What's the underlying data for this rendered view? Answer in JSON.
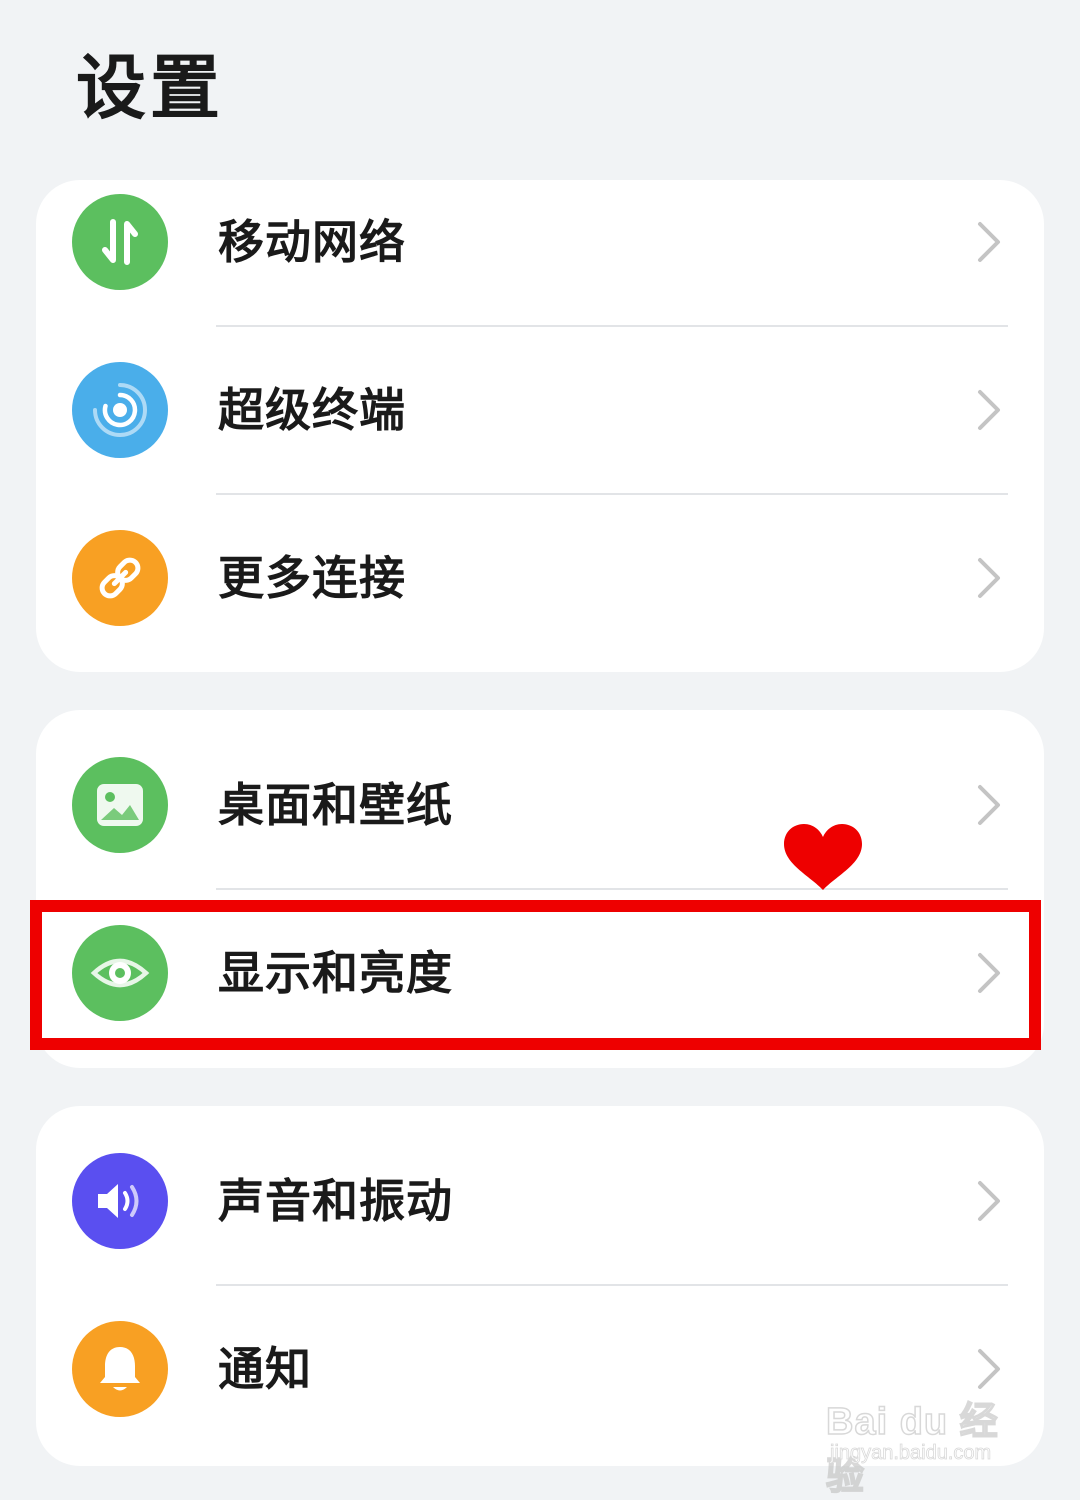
{
  "header": {
    "title": "设置"
  },
  "groups": [
    {
      "items": [
        {
          "label": "移动网络",
          "icon": "mobile-data-icon",
          "color": "#5cbf5f"
        },
        {
          "label": "超级终端",
          "icon": "super-device-icon",
          "color": "#4aaeea"
        },
        {
          "label": "更多连接",
          "icon": "link-icon",
          "color": "#f8a023"
        }
      ]
    },
    {
      "items": [
        {
          "label": "桌面和壁纸",
          "icon": "wallpaper-icon",
          "color": "#5cbf5f"
        },
        {
          "label": "显示和亮度",
          "icon": "eye-icon",
          "color": "#5cbf5f"
        }
      ]
    },
    {
      "items": [
        {
          "label": "声音和振动",
          "icon": "sound-icon",
          "color": "#5a4ff0"
        },
        {
          "label": "通知",
          "icon": "bell-icon",
          "color": "#f8a023"
        }
      ]
    }
  ],
  "annotation": {
    "highlight_color": "#ee0000",
    "heart_color": "#ee0000"
  },
  "watermark": {
    "logo_text": "Bai du 经验",
    "url_text": "jingyan.baidu.com"
  }
}
